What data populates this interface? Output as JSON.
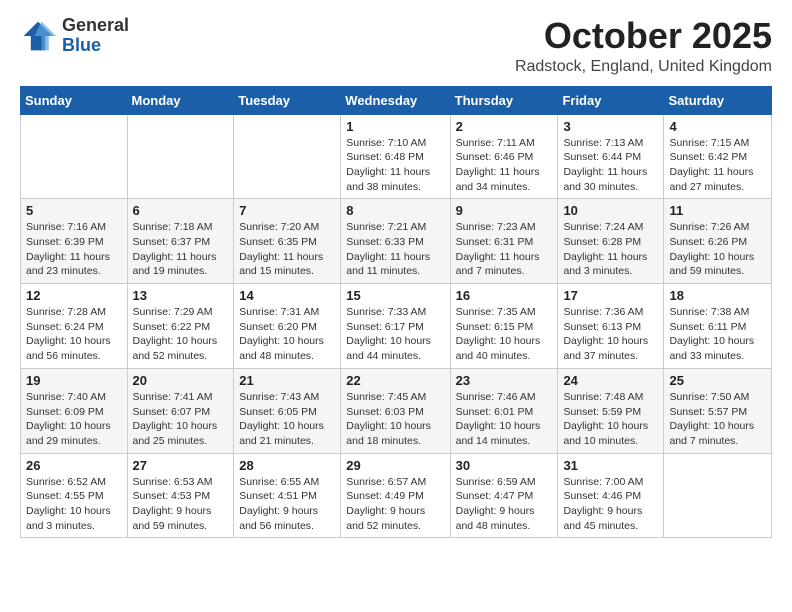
{
  "logo": {
    "general": "General",
    "blue": "Blue"
  },
  "title": "October 2025",
  "location": "Radstock, England, United Kingdom",
  "weekdays": [
    "Sunday",
    "Monday",
    "Tuesday",
    "Wednesday",
    "Thursday",
    "Friday",
    "Saturday"
  ],
  "weeks": [
    [
      {
        "day": "",
        "info": ""
      },
      {
        "day": "",
        "info": ""
      },
      {
        "day": "",
        "info": ""
      },
      {
        "day": "1",
        "info": "Sunrise: 7:10 AM\nSunset: 6:48 PM\nDaylight: 11 hours\nand 38 minutes."
      },
      {
        "day": "2",
        "info": "Sunrise: 7:11 AM\nSunset: 6:46 PM\nDaylight: 11 hours\nand 34 minutes."
      },
      {
        "day": "3",
        "info": "Sunrise: 7:13 AM\nSunset: 6:44 PM\nDaylight: 11 hours\nand 30 minutes."
      },
      {
        "day": "4",
        "info": "Sunrise: 7:15 AM\nSunset: 6:42 PM\nDaylight: 11 hours\nand 27 minutes."
      }
    ],
    [
      {
        "day": "5",
        "info": "Sunrise: 7:16 AM\nSunset: 6:39 PM\nDaylight: 11 hours\nand 23 minutes."
      },
      {
        "day": "6",
        "info": "Sunrise: 7:18 AM\nSunset: 6:37 PM\nDaylight: 11 hours\nand 19 minutes."
      },
      {
        "day": "7",
        "info": "Sunrise: 7:20 AM\nSunset: 6:35 PM\nDaylight: 11 hours\nand 15 minutes."
      },
      {
        "day": "8",
        "info": "Sunrise: 7:21 AM\nSunset: 6:33 PM\nDaylight: 11 hours\nand 11 minutes."
      },
      {
        "day": "9",
        "info": "Sunrise: 7:23 AM\nSunset: 6:31 PM\nDaylight: 11 hours\nand 7 minutes."
      },
      {
        "day": "10",
        "info": "Sunrise: 7:24 AM\nSunset: 6:28 PM\nDaylight: 11 hours\nand 3 minutes."
      },
      {
        "day": "11",
        "info": "Sunrise: 7:26 AM\nSunset: 6:26 PM\nDaylight: 10 hours\nand 59 minutes."
      }
    ],
    [
      {
        "day": "12",
        "info": "Sunrise: 7:28 AM\nSunset: 6:24 PM\nDaylight: 10 hours\nand 56 minutes."
      },
      {
        "day": "13",
        "info": "Sunrise: 7:29 AM\nSunset: 6:22 PM\nDaylight: 10 hours\nand 52 minutes."
      },
      {
        "day": "14",
        "info": "Sunrise: 7:31 AM\nSunset: 6:20 PM\nDaylight: 10 hours\nand 48 minutes."
      },
      {
        "day": "15",
        "info": "Sunrise: 7:33 AM\nSunset: 6:17 PM\nDaylight: 10 hours\nand 44 minutes."
      },
      {
        "day": "16",
        "info": "Sunrise: 7:35 AM\nSunset: 6:15 PM\nDaylight: 10 hours\nand 40 minutes."
      },
      {
        "day": "17",
        "info": "Sunrise: 7:36 AM\nSunset: 6:13 PM\nDaylight: 10 hours\nand 37 minutes."
      },
      {
        "day": "18",
        "info": "Sunrise: 7:38 AM\nSunset: 6:11 PM\nDaylight: 10 hours\nand 33 minutes."
      }
    ],
    [
      {
        "day": "19",
        "info": "Sunrise: 7:40 AM\nSunset: 6:09 PM\nDaylight: 10 hours\nand 29 minutes."
      },
      {
        "day": "20",
        "info": "Sunrise: 7:41 AM\nSunset: 6:07 PM\nDaylight: 10 hours\nand 25 minutes."
      },
      {
        "day": "21",
        "info": "Sunrise: 7:43 AM\nSunset: 6:05 PM\nDaylight: 10 hours\nand 21 minutes."
      },
      {
        "day": "22",
        "info": "Sunrise: 7:45 AM\nSunset: 6:03 PM\nDaylight: 10 hours\nand 18 minutes."
      },
      {
        "day": "23",
        "info": "Sunrise: 7:46 AM\nSunset: 6:01 PM\nDaylight: 10 hours\nand 14 minutes."
      },
      {
        "day": "24",
        "info": "Sunrise: 7:48 AM\nSunset: 5:59 PM\nDaylight: 10 hours\nand 10 minutes."
      },
      {
        "day": "25",
        "info": "Sunrise: 7:50 AM\nSunset: 5:57 PM\nDaylight: 10 hours\nand 7 minutes."
      }
    ],
    [
      {
        "day": "26",
        "info": "Sunrise: 6:52 AM\nSunset: 4:55 PM\nDaylight: 10 hours\nand 3 minutes."
      },
      {
        "day": "27",
        "info": "Sunrise: 6:53 AM\nSunset: 4:53 PM\nDaylight: 9 hours\nand 59 minutes."
      },
      {
        "day": "28",
        "info": "Sunrise: 6:55 AM\nSunset: 4:51 PM\nDaylight: 9 hours\nand 56 minutes."
      },
      {
        "day": "29",
        "info": "Sunrise: 6:57 AM\nSunset: 4:49 PM\nDaylight: 9 hours\nand 52 minutes."
      },
      {
        "day": "30",
        "info": "Sunrise: 6:59 AM\nSunset: 4:47 PM\nDaylight: 9 hours\nand 48 minutes."
      },
      {
        "day": "31",
        "info": "Sunrise: 7:00 AM\nSunset: 4:46 PM\nDaylight: 9 hours\nand 45 minutes."
      },
      {
        "day": "",
        "info": ""
      }
    ]
  ]
}
